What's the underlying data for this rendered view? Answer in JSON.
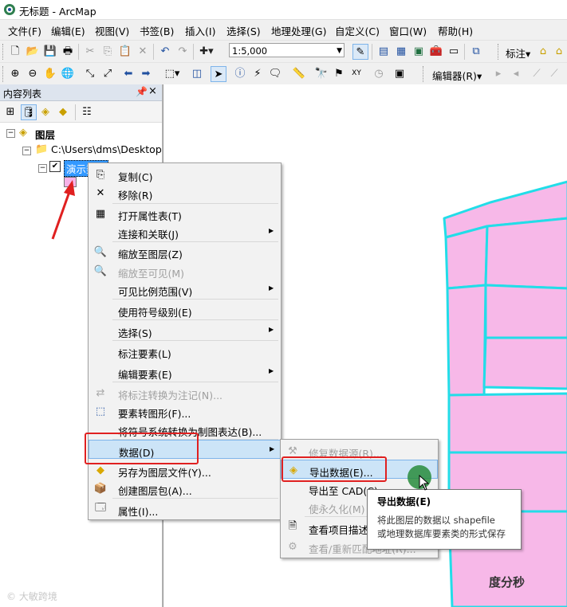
{
  "window": {
    "title": "无标题 - ArcMap"
  },
  "menubar": [
    "文件(F)",
    "编辑(E)",
    "视图(V)",
    "书签(B)",
    "插入(I)",
    "选择(S)",
    "地理处理(G)",
    "自定义(C)",
    "窗口(W)",
    "帮助(H)"
  ],
  "toolbar": {
    "scale_value": "1:5,000",
    "label_toolbar": "标注▾",
    "editor_label": "编辑器(R)▾"
  },
  "toc": {
    "title": "内容列表",
    "pin": "ᵖ",
    "close": "×",
    "root_label": "图层",
    "folder_label": "C:\\Users\\dms\\Desktop",
    "layer_label": "演示数据",
    "layer_checked": true,
    "symbol_color": "#f7b3e8"
  },
  "context_menu": {
    "items": [
      {
        "label": "复制(C)",
        "icon": "copy-icon",
        "disabled": false,
        "submenu": false
      },
      {
        "label": "移除(R)",
        "icon": "remove-icon",
        "disabled": false,
        "submenu": false
      },
      {
        "label": "打开属性表(T)",
        "icon": "table-icon",
        "disabled": false,
        "submenu": false
      },
      {
        "label": "连接和关联(J)",
        "icon": "",
        "disabled": false,
        "submenu": true
      },
      {
        "label": "缩放至图层(Z)",
        "icon": "zoom-layer-icon",
        "disabled": false,
        "submenu": false
      },
      {
        "label": "缩放至可见(M)",
        "icon": "zoom-visible-icon",
        "disabled": true,
        "submenu": false
      },
      {
        "label": "可见比例范围(V)",
        "icon": "",
        "disabled": false,
        "submenu": true
      },
      {
        "label": "使用符号级别(E)",
        "icon": "",
        "disabled": false,
        "submenu": false
      },
      {
        "label": "选择(S)",
        "icon": "",
        "disabled": false,
        "submenu": true
      },
      {
        "label": "标注要素(L)",
        "icon": "",
        "disabled": false,
        "submenu": false
      },
      {
        "label": "编辑要素(E)",
        "icon": "",
        "disabled": false,
        "submenu": true
      },
      {
        "label": "将标注转换为注记(N)...",
        "icon": "convert-labels-icon",
        "disabled": true,
        "submenu": false
      },
      {
        "label": "要素转图形(F)...",
        "icon": "feature-graphics-icon",
        "disabled": false,
        "submenu": false
      },
      {
        "label": "将符号系统转换为制图表达(B)...",
        "icon": "",
        "disabled": false,
        "submenu": false
      },
      {
        "label": "数据(D)",
        "icon": "",
        "disabled": false,
        "submenu": true,
        "highlighted": true
      },
      {
        "label": "另存为图层文件(Y)...",
        "icon": "layer-file-icon",
        "disabled": false,
        "submenu": false
      },
      {
        "label": "创建图层包(A)...",
        "icon": "layer-package-icon",
        "disabled": false,
        "submenu": false
      },
      {
        "label": "属性(I)...",
        "icon": "properties-icon",
        "disabled": false,
        "submenu": false
      }
    ]
  },
  "submenu": {
    "items": [
      {
        "label": "修复数据源(R)...",
        "icon": "repair-icon",
        "disabled": true
      },
      {
        "label": "导出数据(E)...",
        "icon": "export-data-icon",
        "disabled": false,
        "highlighted": true
      },
      {
        "label": "导出至 CAD(C)...",
        "icon": "",
        "disabled": false
      },
      {
        "label": "使永久化(M)",
        "icon": "",
        "disabled": true
      },
      {
        "label": "查看项目描述",
        "icon": "describe-icon",
        "disabled": false
      },
      {
        "label": "查看/重新匹配地址(R)...",
        "icon": "rematch-icon",
        "disabled": true
      }
    ]
  },
  "tooltip": {
    "title": "导出数据(E)",
    "line1": "将此图层的数据以 shapefile",
    "line2": "或地理数据库要素类的形式保存"
  },
  "watermarks": {
    "left": "© 大敏跨境",
    "right": "度分秒"
  },
  "colors": {
    "parcel_fill": "#f7b8e8",
    "parcel_outline": "#22dde8",
    "highlight_box": "#e02020"
  }
}
